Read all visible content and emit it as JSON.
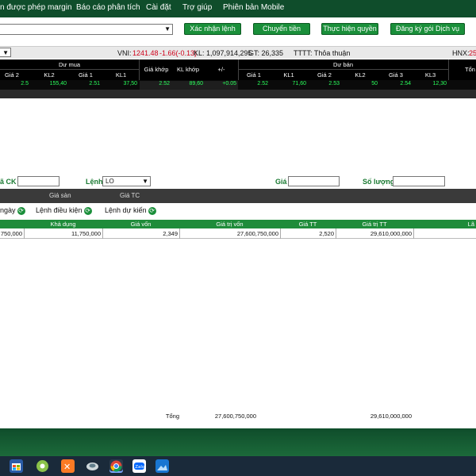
{
  "nav": {
    "items": [
      "n được phép margin",
      "Báo cáo phân tích",
      "Cài đặt",
      "Trợ giúp",
      "Phiên bản Mobile"
    ]
  },
  "actions": {
    "confirm_label": "Xác nhận lệnh",
    "transfer_label": "Chuyển tiền",
    "rights_label": "Thực hiện quyền",
    "register_label": "Đăng ký gói Dịch vụ"
  },
  "index": {
    "vni_label": "VNI:",
    "vni_value": "1241.48",
    "vni_change": "-1.66(-0.13)",
    "kl": "KL: 1,097,914,295",
    "gt": "GT: 26,335",
    "tttt": "TTTT: Thỏa thuận",
    "hnx_label": "HNX:",
    "hnx_value": "25"
  },
  "board": {
    "buy_group": "Dư mua",
    "sell_group": "Dư bán",
    "headers_buy": [
      "Giá 2",
      "KL2",
      "Giá 1",
      "KL1"
    ],
    "match_headers": [
      "Giá khớp",
      "KL khớp",
      "+/-"
    ],
    "headers_sell": [
      "Giá 1",
      "KL1",
      "Giá 2",
      "KL2",
      "Giá 3",
      "KL3"
    ],
    "total_header": "Tổn",
    "values": [
      "2.5",
      "155,40",
      "2.51",
      "37,50",
      "2.52",
      "89,60",
      "+0.05",
      "2.52",
      "71,60",
      "2.53",
      "50",
      "2.54",
      "12,30"
    ]
  },
  "order": {
    "symbol_label": "ã CK",
    "type_label": "Lệnh",
    "type_value": "LO",
    "price_label": "Giá",
    "qty_label": "Số lượng"
  },
  "limits": {
    "ceiling": "",
    "floor": "Giá sàn",
    "ref": "Giá TC"
  },
  "order_tabs": {
    "normal": "ngày",
    "conditional": "Lệnh điều kiện",
    "planned": "Lệnh dự kiến"
  },
  "portfolio": {
    "headers": [
      "",
      "Khả dụng",
      "Giá vốn",
      "Giá trị vốn",
      "Giá TT",
      "Giá trị TT",
      "Lã"
    ],
    "row": [
      "750,000",
      "11,750,000",
      "2,349",
      "27,600,750,000",
      "2,520",
      "29,610,000,000",
      ""
    ],
    "total_label": "Tổng",
    "total_cost": "27,600,750,000",
    "total_market": "29,610,000,000"
  },
  "colors": {
    "nav_bg": "#0f4d2b",
    "button_green": "#1a8f3a",
    "price_up": "#29ff5a",
    "index_down": "#d0021b"
  },
  "taskbar": {
    "icons": [
      "windows-store-icon",
      "chrome-old-icon",
      "xampp-icon",
      "network-icon",
      "chrome-icon",
      "zalo-icon",
      "photos-icon"
    ]
  }
}
